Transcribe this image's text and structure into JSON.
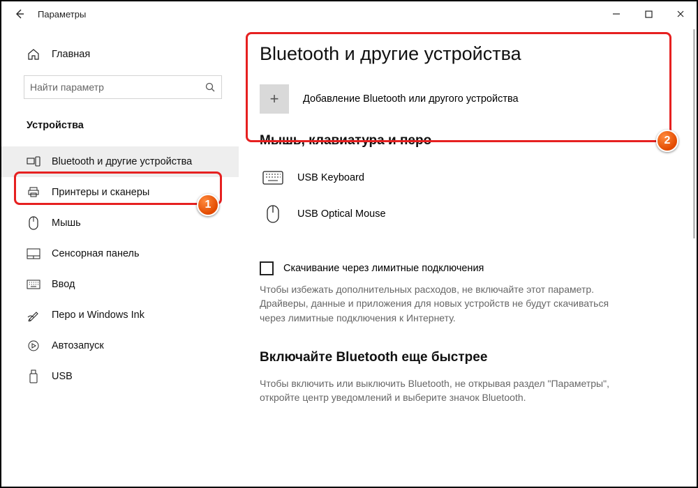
{
  "titlebar": {
    "title": "Параметры"
  },
  "sidebar": {
    "home": "Главная",
    "search_placeholder": "Найти параметр",
    "section": "Устройства",
    "items": [
      {
        "label": "Bluetooth и другие устройства",
        "icon": "bluetooth"
      },
      {
        "label": "Принтеры и сканеры",
        "icon": "printer"
      },
      {
        "label": "Мышь",
        "icon": "mouse"
      },
      {
        "label": "Сенсорная панель",
        "icon": "touchpad"
      },
      {
        "label": "Ввод",
        "icon": "keyboard"
      },
      {
        "label": "Перо и Windows Ink",
        "icon": "pen"
      },
      {
        "label": "Автозапуск",
        "icon": "autoplay"
      },
      {
        "label": "USB",
        "icon": "usb"
      }
    ]
  },
  "content": {
    "page_title": "Bluetooth и другие устройства",
    "add_label": "Добавление Bluetooth или другого устройства",
    "section_input": "Мышь, клавиатура и перо",
    "devices": [
      {
        "name": "USB Keyboard",
        "icon": "keyboard"
      },
      {
        "name": "USB Optical Mouse",
        "icon": "mouse"
      }
    ],
    "metered_checkbox": "Скачивание через лимитные подключения",
    "metered_help": "Чтобы избежать дополнительных расходов, не включайте этот параметр. Драйверы, данные и приложения для новых устройств не будут скачиваться через лимитные подключения к Интернету.",
    "fast_title": "Включайте Bluetooth еще быстрее",
    "fast_help": "Чтобы включить или выключить Bluetooth, не открывая раздел \"Параметры\", откройте центр уведомлений и выберите значок Bluetooth."
  },
  "annotations": {
    "badge1": "1",
    "badge2": "2"
  }
}
